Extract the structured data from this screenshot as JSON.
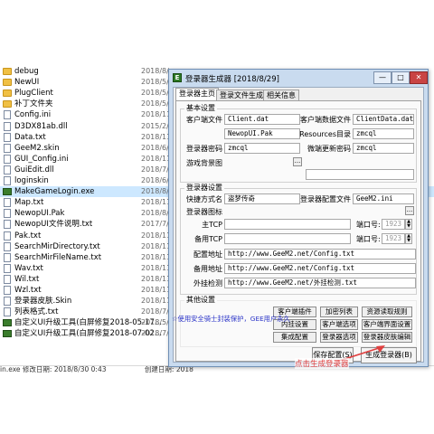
{
  "explorer": {
    "files": [
      {
        "name": "debug",
        "type": "folder",
        "date": "2018/8/"
      },
      {
        "name": "NewUI",
        "type": "folder",
        "date": "2018/5/"
      },
      {
        "name": "PlugClient",
        "type": "folder",
        "date": "2018/5/"
      },
      {
        "name": "补丁文件夹",
        "type": "folder",
        "date": "2018/5/"
      },
      {
        "name": "Config.ini",
        "type": "file",
        "date": "2018/11"
      },
      {
        "name": "D3DX81ab.dll",
        "type": "file",
        "date": "2015/2/"
      },
      {
        "name": "Data.txt",
        "type": "file",
        "date": "2018/11"
      },
      {
        "name": "GeeM2.skin",
        "type": "file",
        "date": "2018/6/"
      },
      {
        "name": "GUI_Config.ini",
        "type": "file",
        "date": "2018/11"
      },
      {
        "name": "GuiEdit.dll",
        "type": "file",
        "date": "2018/7/"
      },
      {
        "name": "loginskin",
        "type": "file",
        "date": "2018/6/"
      },
      {
        "name": "MakeGameLogin.exe",
        "type": "exe",
        "date": "2018/8/"
      },
      {
        "name": "Map.txt",
        "type": "file",
        "date": "2018/11"
      },
      {
        "name": "NewopUI.Pak",
        "type": "file",
        "date": "2018/8/"
      },
      {
        "name": "NewopUI文件说明.txt",
        "type": "file",
        "date": "2017/7/"
      },
      {
        "name": "Pak.txt",
        "type": "file",
        "date": "2018/11"
      },
      {
        "name": "SearchMirDirectory.txt",
        "type": "file",
        "date": "2018/11"
      },
      {
        "name": "SearchMirFileName.txt",
        "type": "file",
        "date": "2018/11"
      },
      {
        "name": "Wav.txt",
        "type": "file",
        "date": "2018/11"
      },
      {
        "name": "Wil.txt",
        "type": "file",
        "date": "2018/11"
      },
      {
        "name": "Wzl.txt",
        "type": "file",
        "date": "2018/11"
      },
      {
        "name": "登录器皮肤.Skin",
        "type": "file",
        "date": "2018/11"
      },
      {
        "name": "列表格式.txt",
        "type": "file",
        "date": "2018/7/"
      },
      {
        "name": "自定义UI升级工具(白屏修复2018-05-17...",
        "type": "exe",
        "date": "2018/5/"
      },
      {
        "name": "自定义UI升级工具(白屏修复2018-07-02...",
        "type": "exe",
        "date": "2018/7/"
      }
    ],
    "status_text": "in.exe  修改日期: 2018/8/30 0:43",
    "status_created": "创建日期: 2018"
  },
  "dialog": {
    "title": "登录器生成器 [2018/8/29]",
    "app_icon_glyph": "E",
    "min_glyph": "—",
    "max_glyph": "□",
    "close_glyph": "✕",
    "tabs": [
      "登录器主页",
      "登录文件生成",
      "相关信息"
    ],
    "basic": {
      "title": "基本设置",
      "client_file_label": "客户端文件",
      "client_file_value": "Client.dat",
      "list_file_label": "客户端数据文件",
      "list_file_value": "ClientData.dat",
      "newopui_value": "NewopUI.Pak",
      "resources_label": "Resources目录",
      "resources_value": "zmcql",
      "login_pwd_label": "登录器密码",
      "login_pwd_value": "zmcql",
      "micro_pwd_label": "微端更新密码",
      "micro_pwd_value": "zmcql",
      "bg_label": "游戏背景图",
      "browse_glyph": "..."
    },
    "login": {
      "title": "登录器设置",
      "shortcut_label": "快捷方式名",
      "shortcut_value": "盗梦传奇",
      "config_label": "登录器配置文件",
      "config_value": "GeeM2.ini",
      "icon_label": "登录器图标",
      "main_tcp_label": "主TCP",
      "main_tcp_value": "",
      "port1_label": "端口号:",
      "port1_value": "1923",
      "backup_tcp_label": "备用TCP",
      "backup_tcp_value": "",
      "port2_label": "端口号:",
      "port2_value": "1923",
      "config_url_label": "配置地址",
      "config_url_value": "http://www.GeeM2.net/Config.txt",
      "backup_url_label": "备用地址",
      "backup_url_value": "http://www.GeeM2.net/Config.txt",
      "plugin_check_label": "外挂检测",
      "plugin_check_value": "http://www.GeeM2.net/外挂检测.txt"
    },
    "other": {
      "title": "其他设置",
      "buttons": [
        "客户端插件",
        "加密列表",
        "资源读取规则",
        "内挂设置",
        "客户端选项",
        "客户端界面设置",
        "集成配置",
        "登录器选项",
        "登录器皮肤编辑"
      ]
    },
    "notice": "☆使用安全骑士封装保护，GEE用户永久",
    "save_button": "保存配置(S)",
    "generate_button": "生成登录器(B)"
  },
  "annotation": {
    "text": "点击生成登录器",
    "color": "#e04040"
  }
}
